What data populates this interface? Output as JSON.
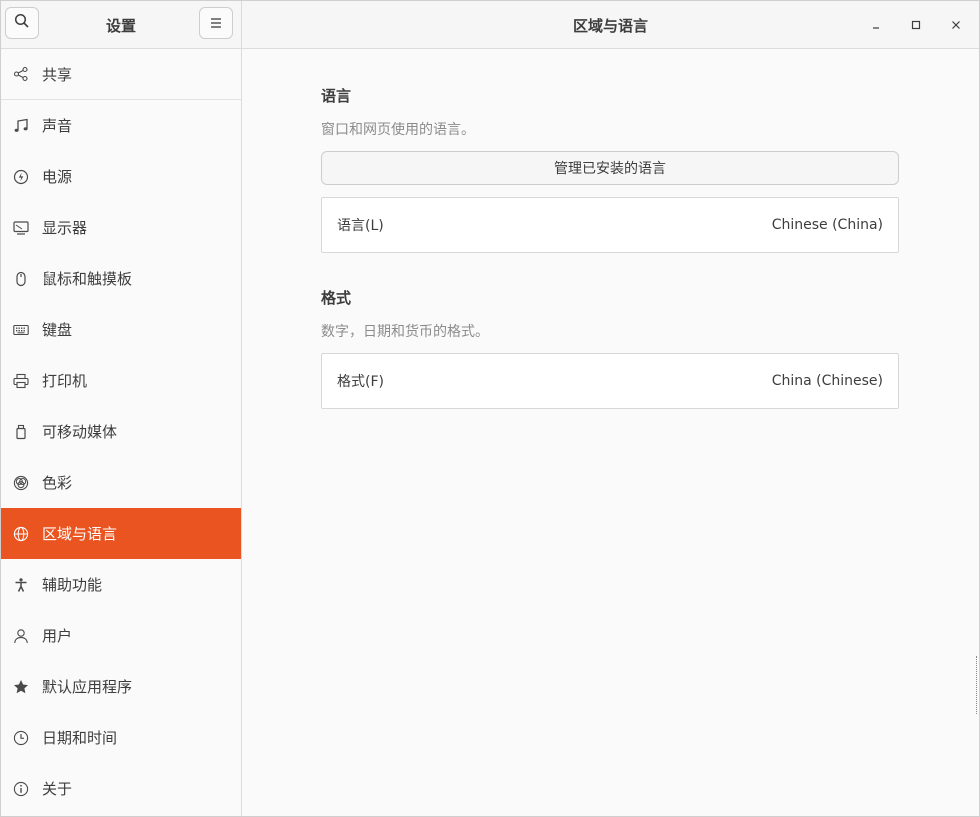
{
  "sidebar": {
    "title": "设置",
    "search_icon": "search-icon",
    "menu_icon": "hamburger-menu-icon",
    "items": [
      {
        "label": "共享",
        "icon": "share-icon"
      },
      {
        "label": "声音",
        "icon": "music-note-icon"
      },
      {
        "label": "电源",
        "icon": "power-icon"
      },
      {
        "label": "显示器",
        "icon": "display-icon"
      },
      {
        "label": "鼠标和触摸板",
        "icon": "mouse-icon"
      },
      {
        "label": "键盘",
        "icon": "keyboard-icon"
      },
      {
        "label": "打印机",
        "icon": "printer-icon"
      },
      {
        "label": "可移动媒体",
        "icon": "removable-media-icon"
      },
      {
        "label": "色彩",
        "icon": "color-icon"
      },
      {
        "label": "区域与语言",
        "icon": "globe-icon",
        "active": true
      },
      {
        "label": "辅助功能",
        "icon": "accessibility-icon"
      },
      {
        "label": "用户",
        "icon": "user-icon"
      },
      {
        "label": "默认应用程序",
        "icon": "star-icon"
      },
      {
        "label": "日期和时间",
        "icon": "clock-icon"
      },
      {
        "label": "关于",
        "icon": "info-icon"
      }
    ],
    "active_color": "#e95420"
  },
  "main": {
    "title": "区域与语言",
    "language": {
      "title": "语言",
      "description": "窗口和网页使用的语言。",
      "manage_button": "管理已安装的语言",
      "row_label": "语言(L)",
      "row_value": "Chinese (China)"
    },
    "formats": {
      "title": "格式",
      "description": "数字，日期和货币的格式。",
      "row_label": "格式(F)",
      "row_value": "China (Chinese)"
    }
  }
}
